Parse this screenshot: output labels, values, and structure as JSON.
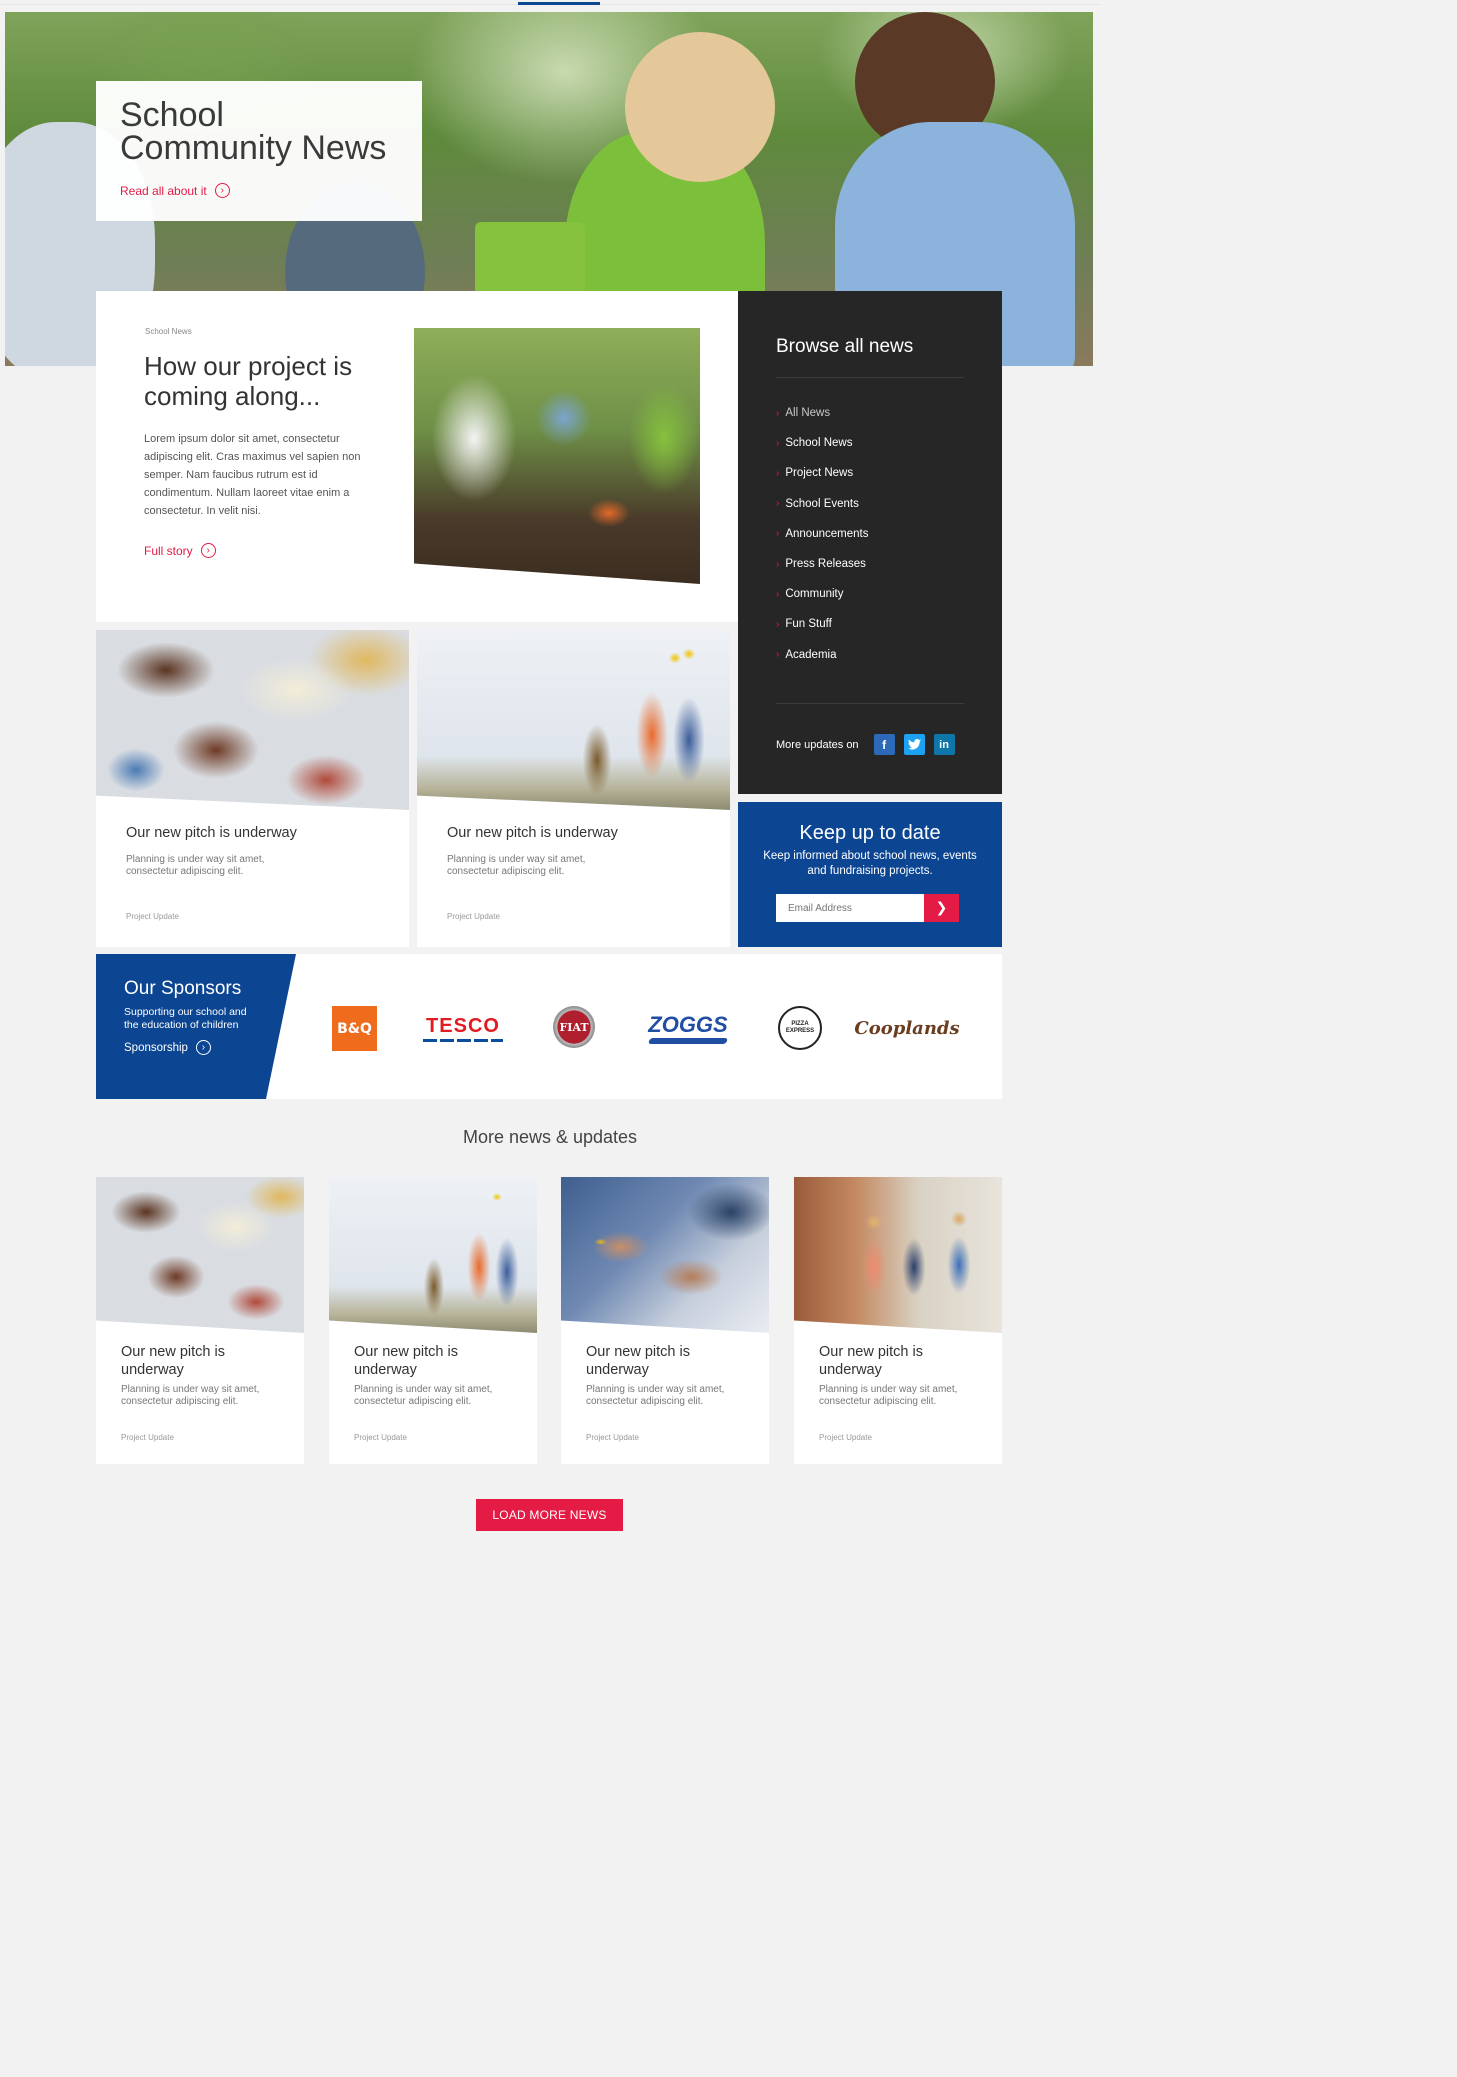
{
  "colors": {
    "accent": "#e31b45",
    "navy": "#0c4592",
    "dark": "#262626",
    "facebook": "#2c69b8",
    "twitter": "#1da1f2",
    "linkedin": "#0e76a8"
  },
  "hero": {
    "title": "School Community News",
    "link": "Read all about it"
  },
  "feature": {
    "category": "School News",
    "title": "How our project is coming along...",
    "body": "Lorem ipsum dolor sit amet, consectetur adipiscing elit. Cras maximus vel sapien non semper. Nam faucibus rutrum est id condimentum. Nullam laoreet vitae enim a consectetur. In velit nisi.",
    "link": "Full story"
  },
  "browse": {
    "title": "Browse all news",
    "items": [
      {
        "label": "All News"
      },
      {
        "label": "School News"
      },
      {
        "label": "Project News"
      },
      {
        "label": "School Events"
      },
      {
        "label": "Announcements"
      },
      {
        "label": "Press Releases"
      },
      {
        "label": "Community"
      },
      {
        "label": "Fun Stuff"
      },
      {
        "label": "Academia"
      }
    ],
    "social_label": "More updates on",
    "social": [
      "f",
      "t",
      "in"
    ]
  },
  "newsletter": {
    "title": "Keep up to date",
    "text": "Keep informed about school news, events and fundraising projects.",
    "placeholder": "Email Address"
  },
  "cards_top": [
    {
      "title": "Our new pitch is underway",
      "desc": "Planning is under way sit amet, consectetur adipiscing elit.",
      "tag": "Project Update",
      "image": "bake-sale-photo"
    },
    {
      "title": "Our new pitch is underway",
      "desc": "Planning is under way sit amet, consectetur adipiscing elit.",
      "tag": "Project Update",
      "image": "surveyors-photo"
    }
  ],
  "sponsors": {
    "title": "Our Sponsors",
    "text": "Supporting our school and the education of children",
    "link": "Sponsorship",
    "logos": [
      "B&Q",
      "TESCO",
      "FIAT",
      "ZOGGS",
      "PIZZA EXPRESS",
      "Cooplands"
    ]
  },
  "more_news": {
    "heading": "More news & updates",
    "cards": [
      {
        "title": "Our new pitch is underway",
        "desc": "Planning is under way sit amet, consectetur adipiscing elit.",
        "tag": "Project Update",
        "image": "bake-sale-photo"
      },
      {
        "title": "Our new pitch is underway",
        "desc": "Planning is under way sit amet, consectetur adipiscing elit.",
        "tag": "Project Update",
        "image": "surveyors-photo"
      },
      {
        "title": "Our new pitch is underway",
        "desc": "Planning is under way sit amet, consectetur adipiscing elit.",
        "tag": "Project Update",
        "image": "blueprints-photo"
      },
      {
        "title": "Our new pitch is underway",
        "desc": "Planning is under way sit amet, consectetur adipiscing elit.",
        "tag": "Project Update",
        "image": "kids-running-photo"
      }
    ],
    "load_more": "LOAD MORE NEWS"
  }
}
